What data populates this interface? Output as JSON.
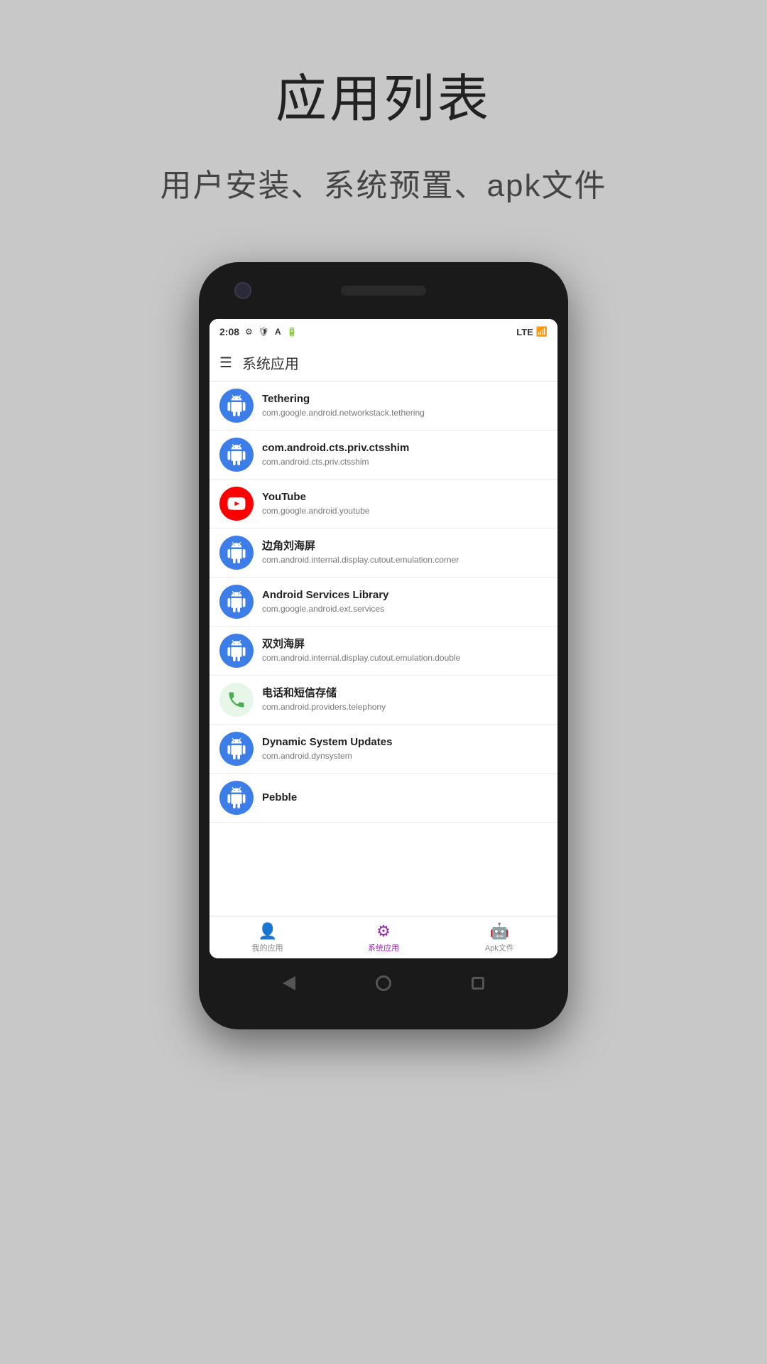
{
  "header": {
    "title": "应用列表",
    "subtitle": "用户安装、系统预置、apk文件"
  },
  "status_bar": {
    "time": "2:08",
    "network": "LTE",
    "icons": [
      "⚙",
      "🛡",
      "A",
      "🔋"
    ]
  },
  "app_bar": {
    "title": "系统应用"
  },
  "apps": [
    {
      "name": "Tethering",
      "package": "com.google.android.networkstack.tethering",
      "icon_type": "android",
      "icon_bg": "#3d7de8"
    },
    {
      "name": "com.android.cts.priv.ctsshim",
      "package": "com.android.cts.priv.ctsshim",
      "icon_type": "android",
      "icon_bg": "#3d7de8"
    },
    {
      "name": "YouTube",
      "package": "com.google.android.youtube",
      "icon_type": "youtube",
      "icon_bg": "#ff0000"
    },
    {
      "name": "边角刘海屏",
      "package": "com.android.internal.display.cutout.emulation.corner",
      "icon_type": "android",
      "icon_bg": "#3d7de8"
    },
    {
      "name": "Android Services Library",
      "package": "com.google.android.ext.services",
      "icon_type": "android",
      "icon_bg": "#3d7de8"
    },
    {
      "name": "双刘海屏",
      "package": "com.android.internal.display.cutout.emulation.double",
      "icon_type": "android",
      "icon_bg": "#3d7de8"
    },
    {
      "name": "电话和短信存储",
      "package": "com.android.providers.telephony",
      "icon_type": "phone",
      "icon_bg": "#e8f5e9"
    },
    {
      "name": "Dynamic System Updates",
      "package": "com.android.dynsystem",
      "icon_type": "android",
      "icon_bg": "#3d7de8"
    },
    {
      "name": "Pebble",
      "package": "",
      "icon_type": "android",
      "icon_bg": "#3d7de8"
    }
  ],
  "bottom_nav": {
    "items": [
      {
        "label": "我的应用",
        "icon": "person",
        "active": false
      },
      {
        "label": "系统应用",
        "icon": "gear",
        "active": true
      },
      {
        "label": "Apk文件",
        "icon": "android",
        "active": false
      }
    ]
  }
}
